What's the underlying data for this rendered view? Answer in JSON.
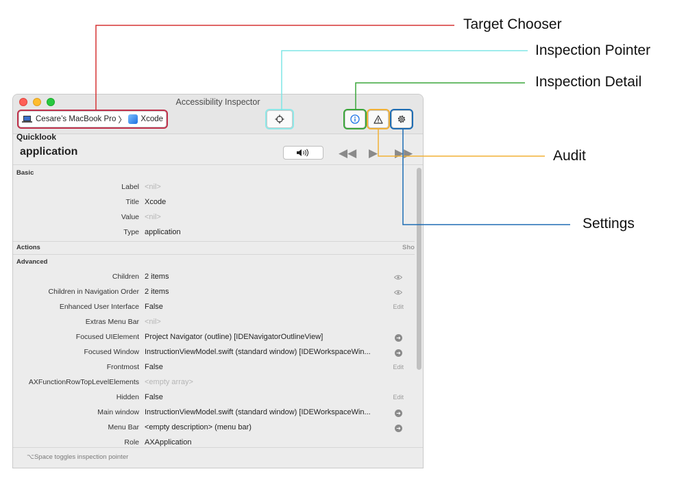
{
  "window": {
    "title": "Accessibility Inspector"
  },
  "target": {
    "device": "Cesare’s MacBook Pro",
    "separator": "〉",
    "app": "Xcode"
  },
  "toolbar": {
    "pointer_icon": "crosshair-icon",
    "detail_icon": "info-icon",
    "audit_icon": "warning-icon",
    "settings_icon": "gear-icon"
  },
  "quicklook": {
    "title": "Quicklook",
    "role": "application",
    "speak_icon": "speaker-icon"
  },
  "sections": {
    "basic": "Basic",
    "actions": "Actions",
    "actions_show": "Sho",
    "advanced": "Advanced"
  },
  "basic_rows": [
    {
      "label": "Label",
      "value": "<nil>"
    },
    {
      "label": "Title",
      "value": "Xcode"
    },
    {
      "label": "Value",
      "value": "<nil>"
    },
    {
      "label": "Type",
      "value": "application"
    }
  ],
  "advanced_rows": [
    {
      "label": "Children",
      "value": "2 items"
    },
    {
      "label": "Children in Navigation Order",
      "value": "2 items"
    },
    {
      "label": "Enhanced User Interface",
      "value": "False",
      "action": "Edit"
    },
    {
      "label": "Extras Menu Bar",
      "value": "<nil>"
    },
    {
      "label": "Focused UIElement",
      "value": "Project Navigator (outline) [IDENavigatorOutlineView]"
    },
    {
      "label": "Focused Window",
      "value": "InstructionViewModel.swift (standard window) [IDEWorkspaceWin..."
    },
    {
      "label": "Frontmost",
      "value": "False",
      "action": "Edit"
    },
    {
      "label": "AXFunctionRowTopLevelElements",
      "value": "<empty array>"
    },
    {
      "label": "Hidden",
      "value": "False",
      "action": "Edit"
    },
    {
      "label": "Main window",
      "value": "InstructionViewModel.swift (standard window) [IDEWorkspaceWin..."
    },
    {
      "label": "Menu Bar",
      "value": "<empty description> (menu bar)"
    },
    {
      "label": "Role",
      "value": "AXApplication"
    }
  ],
  "footer": {
    "hint": "⌥Space toggles inspection pointer"
  },
  "callouts": {
    "target_chooser": "Target Chooser",
    "inspection_pointer": "Inspection Pointer",
    "inspection_detail": "Inspection Detail",
    "audit": "Audit",
    "settings": "Settings"
  },
  "colors": {
    "target_chooser": "#d63333",
    "inspection_pointer": "#7fe6e6",
    "inspection_detail": "#3aa63a",
    "audit": "#f2b135",
    "settings": "#1d6cb3"
  }
}
